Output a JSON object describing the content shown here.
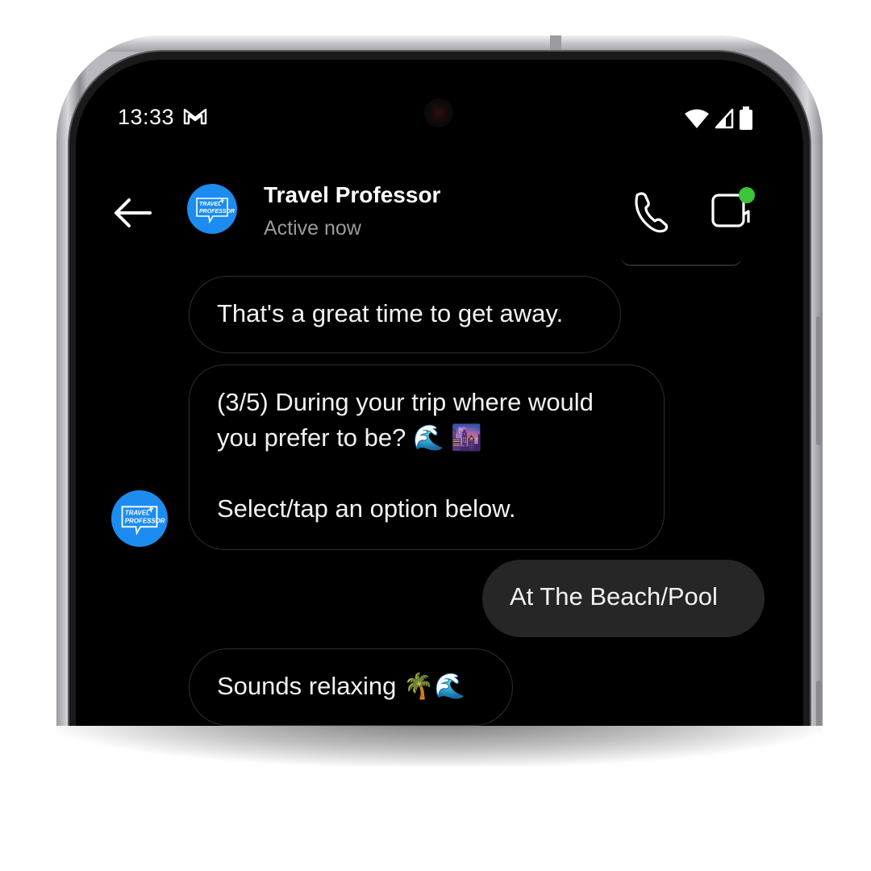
{
  "status_bar": {
    "time": "13:33",
    "notification_icon": "gmail-icon",
    "right_icons": [
      "wifi-icon",
      "cellular-signal-icon",
      "battery-icon"
    ]
  },
  "header": {
    "back_icon": "arrow-left-icon",
    "contact_name": "Travel Professor",
    "contact_status": "Active now",
    "avatar_text": [
      "TRAVEL",
      "PROFESSOR"
    ],
    "actions": [
      "phone-call-icon",
      "video-call-icon"
    ],
    "online_indicator_color": "#3cc43c"
  },
  "messages": [
    {
      "direction": "incoming",
      "text": "That's a great time to get away."
    },
    {
      "direction": "incoming",
      "text": "(3/5) During your trip where would you prefer to be? 🌊 🌆\n\nSelect/tap an option below."
    },
    {
      "direction": "outgoing",
      "text": "At The Beach/Pool"
    },
    {
      "direction": "incoming",
      "text": "Sounds relaxing 🌴🌊"
    }
  ],
  "colors": {
    "brand_blue": "#1d8cf0",
    "screen_bg": "#000000",
    "outgoing_bubble": "#262626",
    "incoming_border": "#2e2e2e",
    "secondary_text": "#9a9a9a"
  }
}
